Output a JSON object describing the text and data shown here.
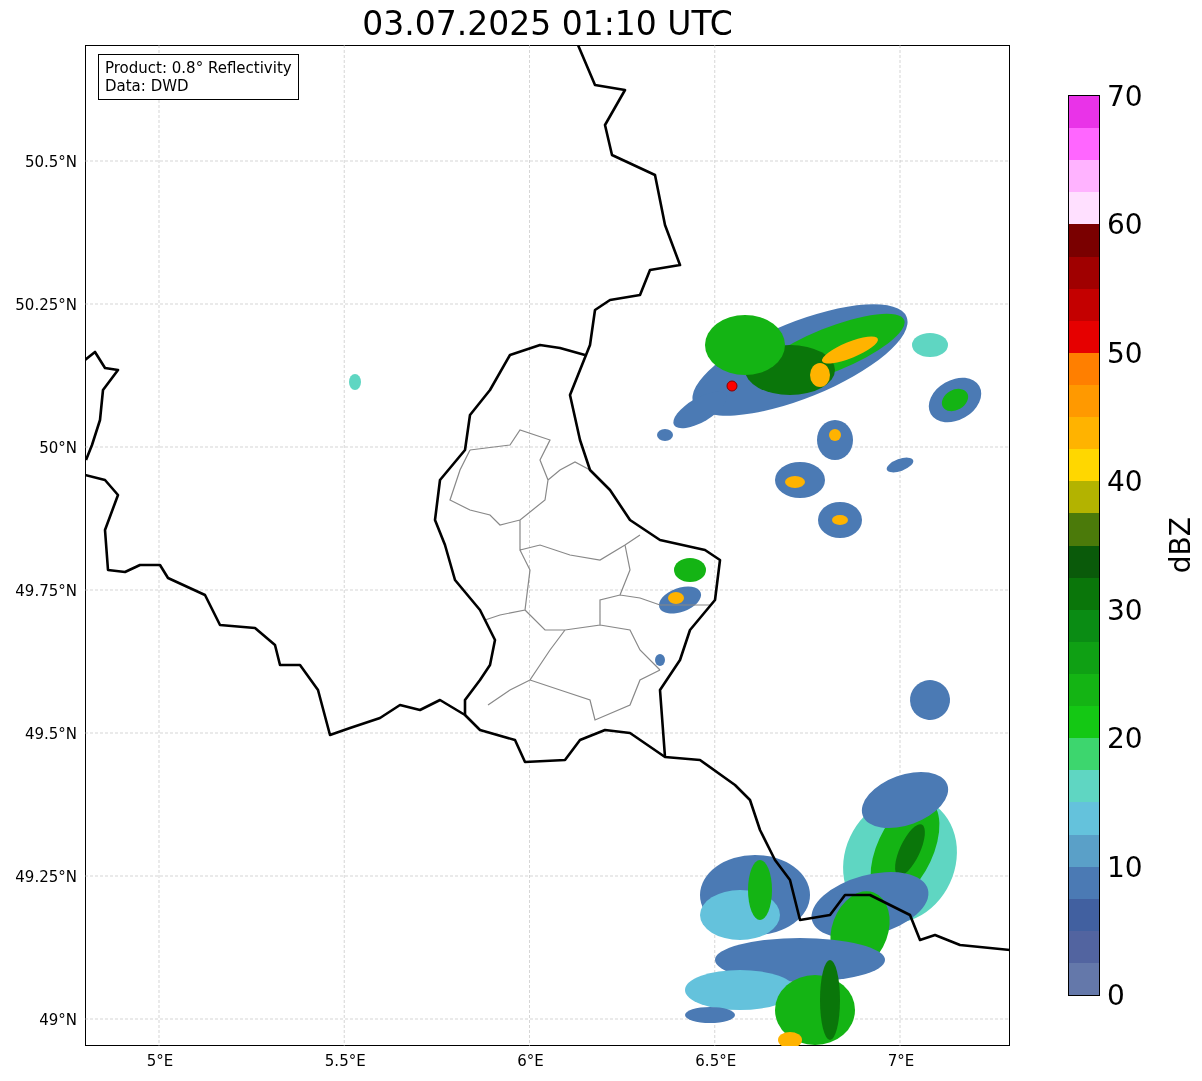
{
  "title": "03.07.2025 01:10 UTC",
  "info_box": [
    "Product: 0.8° Reflectivity",
    "Data: DWD"
  ],
  "lat_labels": [
    "50.5°N",
    "50.25°N",
    "50°N",
    "49.75°N",
    "49.5°N",
    "49.25°N",
    "49°N"
  ],
  "lon_labels": [
    "5°E",
    "5.5°E",
    "6°E",
    "6.5°E",
    "7°E"
  ],
  "colorbar": {
    "label": "dBZ",
    "tick_labels": [
      "70",
      "60",
      "50",
      "40",
      "30",
      "20",
      "10",
      "0"
    ],
    "bands": [
      {
        "color": "#6478aa"
      },
      {
        "color": "#5264a0"
      },
      {
        "color": "#4160a0"
      },
      {
        "color": "#4b7ab4"
      },
      {
        "color": "#5aa0c8"
      },
      {
        "color": "#64c2dc"
      },
      {
        "color": "#5fd6c2"
      },
      {
        "color": "#3dd66e"
      },
      {
        "color": "#14c814"
      },
      {
        "color": "#14b414"
      },
      {
        "color": "#0fa014"
      },
      {
        "color": "#0a8c14"
      },
      {
        "color": "#0a760a"
      },
      {
        "color": "#0a5a0a"
      },
      {
        "color": "#4b7a0a"
      },
      {
        "color": "#b3b300"
      },
      {
        "color": "#ffd700"
      },
      {
        "color": "#ffb300"
      },
      {
        "color": "#ff9900"
      },
      {
        "color": "#ff7f00"
      },
      {
        "color": "#e60000"
      },
      {
        "color": "#c40000"
      },
      {
        "color": "#a00000"
      },
      {
        "color": "#7a0000"
      },
      {
        "color": "#ffe0ff"
      },
      {
        "color": "#ffb3ff"
      },
      {
        "color": "#ff66ff"
      },
      {
        "color": "#e933e8"
      }
    ]
  }
}
